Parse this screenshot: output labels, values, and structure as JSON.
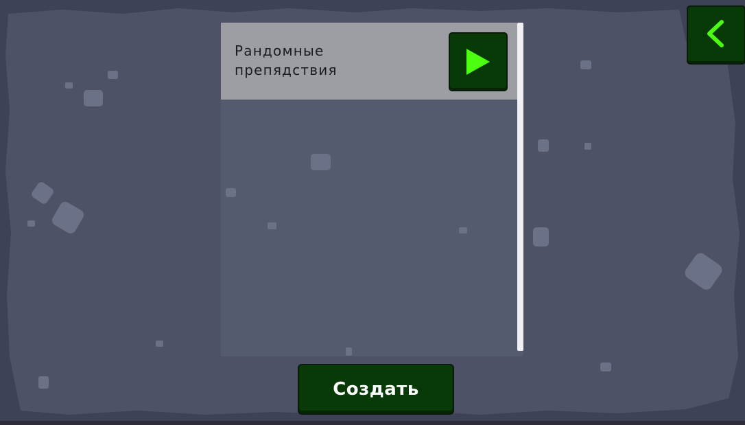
{
  "list": {
    "items": [
      {
        "label": "Рандомные\nпрепядствия"
      }
    ]
  },
  "buttons": {
    "play_icon": "play-icon",
    "back_icon": "chevron-left-icon",
    "create_label": "Создать"
  },
  "colors": {
    "background_outer": "#3d4257",
    "background_inner": "#4d5266",
    "panel": "#555b6f",
    "item": "#9c9ea4",
    "button": "#083a08",
    "icon_accent": "#4cff10"
  }
}
